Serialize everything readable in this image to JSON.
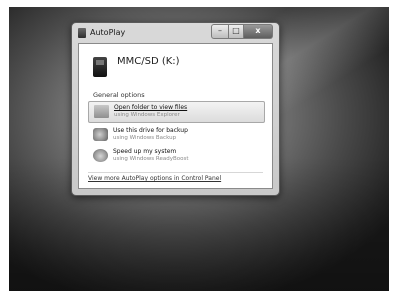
{
  "window": {
    "title": "AutoPlay",
    "caption": {
      "minimize": "–",
      "maximize": "□",
      "close": "x"
    }
  },
  "drive": {
    "name": "MMC/SD (K:)",
    "icon": "sd-card-icon"
  },
  "general_options": {
    "label": "General options",
    "items": [
      {
        "title": "Open folder to view files",
        "subtitle": "using Windows Explorer",
        "icon": "folder-icon",
        "selected": true
      },
      {
        "title": "Use this drive for backup",
        "subtitle": "using Windows Backup",
        "icon": "backup-icon",
        "selected": false
      },
      {
        "title": "Speed up my system",
        "subtitle": "using Windows ReadyBoost",
        "icon": "readyboost-icon",
        "selected": false
      }
    ]
  },
  "more_link": "View more AutoPlay options in Control Panel"
}
